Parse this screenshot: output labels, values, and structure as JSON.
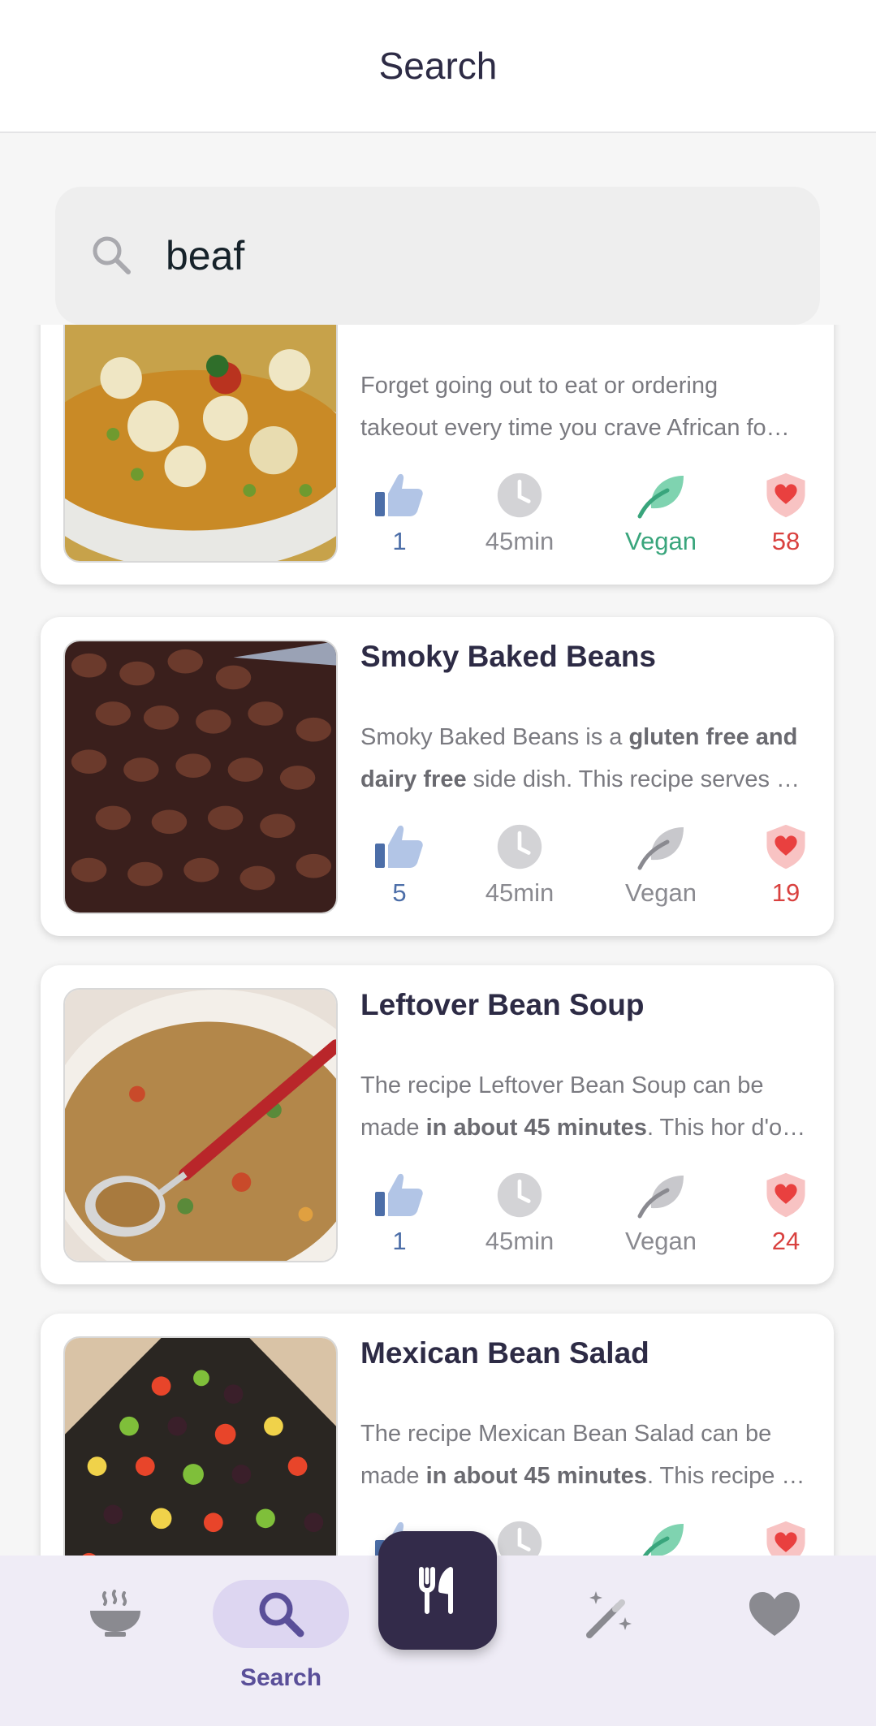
{
  "header": {
    "title": "Search"
  },
  "search": {
    "query": "beaf"
  },
  "recipes": [
    {
      "name": "",
      "desc_line1": "Forget going out to eat or ordering",
      "desc_line2": "takeout every time you crave African fo…",
      "likes": "1",
      "time": "45min",
      "vegan_label": "Vegan",
      "vegan": true,
      "favorites": "58"
    },
    {
      "name": "Smoky Baked Beans",
      "desc1_plain": "Smoky Baked Beans is a ",
      "desc1_bold": "gluten free and",
      "desc2_bold": "dairy free",
      "desc2_plain": " side dish. This recipe serves …",
      "likes": "5",
      "time": "45min",
      "vegan_label": "Vegan",
      "vegan": false,
      "favorites": "19"
    },
    {
      "name": "Leftover Bean Soup",
      "desc1_plain": "The recipe Leftover Bean Soup can be",
      "desc2_pre": "made ",
      "desc2_bold": "in about 45 minutes",
      "desc2_post": ". This hor d'o…",
      "likes": "1",
      "time": "45min",
      "vegan_label": "Vegan",
      "vegan": false,
      "favorites": "24"
    },
    {
      "name": "Mexican Bean Salad",
      "desc1_plain": "The recipe Mexican Bean Salad can be",
      "desc2_pre": "made ",
      "desc2_bold": "in about 45 minutes",
      "desc2_post": ". This recipe …",
      "vegan": true
    }
  ],
  "nav": {
    "search_label": "Search"
  },
  "colors": {
    "accent": "#332b4a",
    "like": "#4c6ea8",
    "vegan": "#39a57c",
    "favorite": "#d9413f",
    "nav_active_bg": "#ddd6f1"
  }
}
